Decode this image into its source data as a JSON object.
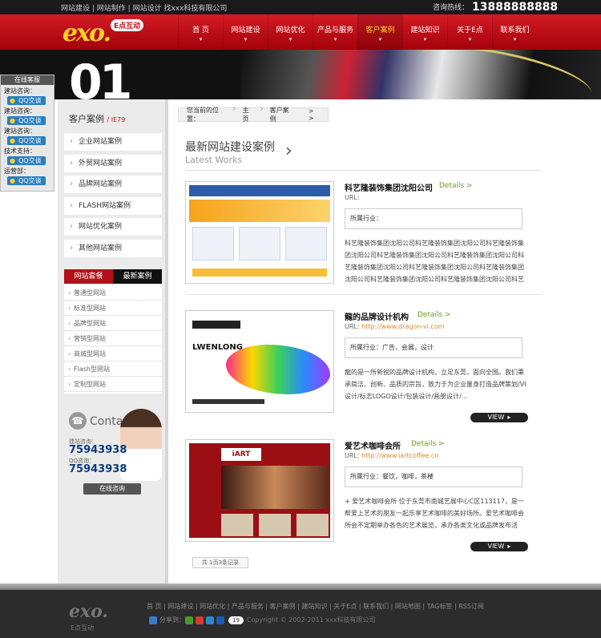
{
  "topbar": {
    "links": [
      "网站建设",
      "网站制作",
      "网站设计",
      "找xxx科技有限公司"
    ],
    "hotline_label": "咨询热线：",
    "hotline_number": "13888888888"
  },
  "header": {
    "logo_text": "exo.",
    "logo_tag": "E点互动",
    "nav": [
      {
        "label": "首 页",
        "active": false
      },
      {
        "label": "网站建设",
        "active": false
      },
      {
        "label": "网站优化",
        "active": false
      },
      {
        "label": "产品与服务",
        "active": false
      },
      {
        "label": "客户案例",
        "active": true
      },
      {
        "label": "建站知识",
        "active": false
      },
      {
        "label": "关于E点",
        "active": false
      },
      {
        "label": "联系我们",
        "active": false
      }
    ]
  },
  "banner": {
    "number": "01"
  },
  "online_service": {
    "title": "在线客服",
    "groups": [
      {
        "label": "建站咨询：",
        "qq": "QQ交谈"
      },
      {
        "label": "建站咨询：",
        "qq": "QQ交谈"
      },
      {
        "label": "建站咨询：",
        "qq": "QQ交谈"
      },
      {
        "label": "技术支持：",
        "qq": "QQ交谈"
      },
      {
        "label": "运营部：",
        "qq": "QQ交谈"
      }
    ]
  },
  "sidebar": {
    "title": "客户案例",
    "subtitle": "/ IE79",
    "items": [
      "企业网站案例",
      "外贸网站案例",
      "品牌网站案例",
      "FLASH网站案例",
      "网站优化案例",
      "其他网站案例"
    ],
    "tabs": [
      "网站套餐",
      "最新案例"
    ],
    "sub_items": [
      "普通型网站",
      "标准型网站",
      "品牌型网站",
      "营销型网站",
      "商城型网站",
      "Flash型网站",
      "定制型网站"
    ],
    "contact": {
      "word": "Contact",
      "label1": "建站咨询：",
      "number1": "75943938",
      "label2": "QQ咨询：",
      "number2": "75943938",
      "button": "在线咨询"
    }
  },
  "breadcrumb": {
    "label": "您当前的位置：",
    "home": "主页",
    "current": "客户案例",
    "more": "> >"
  },
  "section": {
    "title": "最新网站建设案例",
    "subtitle": "Latest Works",
    "arrow": "›"
  },
  "cases": [
    {
      "name": "科艺隆装饰集团沈阳公司",
      "details": "Details >",
      "url_label": "URL:",
      "url": "",
      "industry": "所属行业：",
      "desc": "科艺隆装饰集团沈阳公司科艺隆装饰集团沈阳公司科艺隆装饰集团沈阳公司科艺隆装饰集团沈阳公司科艺隆装饰集团沈阳公司科艺隆装饰集团沈阳公司科艺隆装饰集团沈阳公司科艺隆装饰集团沈阳公司科艺隆装饰集团沈阳公司科艺隆装饰集团沈阳公司科艺隆装饰集团沈阳公...",
      "view": ""
    },
    {
      "name": "龍的品牌设计机构",
      "details": "Details >",
      "url_label": "URL:",
      "url": "http://www.dragon-vi.com",
      "industry": "所属行业：广告，会展，设计",
      "desc": "龍的是一所新锐的品牌设计机构，立足东莞，面向全国。我们秉承简洁、创新、品质的宗旨，致力于为企业量身打造品牌策划/VI设计/标志LOGO设计/包装设计/画册设计/...",
      "view": "VIEW"
    },
    {
      "name": "爱艺术咖啡会所",
      "details": "Details >",
      "url_label": "URL:",
      "url": "http://www.iartcoffee.cn",
      "industry": "所属行业：餐饮，咖啡，茶楼",
      "desc": "+ 爱艺术咖啡会所 位于东莞市南城艺展中心C区113117，是一帮爱上艺术的朋友一起乐享艺术咖啡的美好场所。爱艺术咖啡会所会不定期举办各色的艺术展览，承办各类文化或品牌发布活动...",
      "view": "VIEW"
    }
  ],
  "pager": "共 1页3条记录",
  "footer": {
    "logo": "exo.",
    "logo_sub": "E点互动",
    "links": [
      "首 页",
      "网站建设",
      "网站优化",
      "产品与服务",
      "客户案例",
      "建站知识",
      "关于E点",
      "联系我们",
      "网站地图",
      "TAG标签",
      "RSS订阅"
    ],
    "share_label": "分享到：",
    "share_count": "19",
    "copyright": "Copyright © 2002-2011 xxx科技有限公司"
  },
  "colors": {
    "brand_red": "#c8101a",
    "nav_active": "#ffd12a",
    "details_green": "#6a9a1a",
    "url_orange": "#e08a2a"
  }
}
